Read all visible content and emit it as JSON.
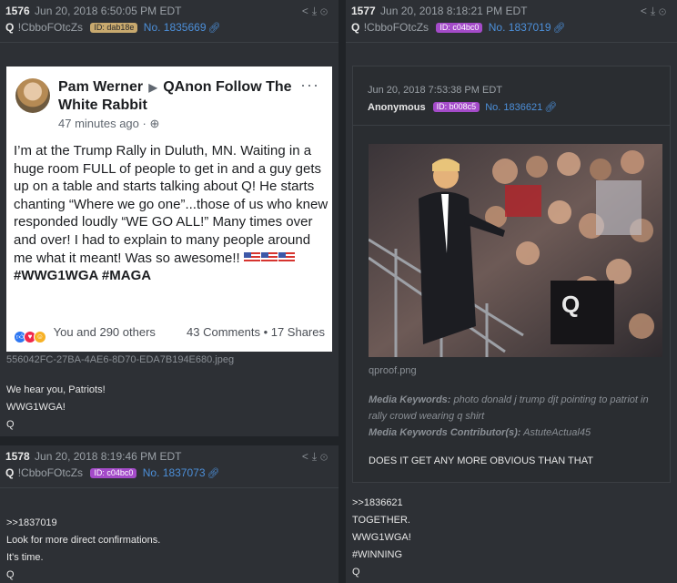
{
  "posts": {
    "p1576": {
      "number": "1576",
      "date": "Jun 20, 2018 6:50:05 PM EDT",
      "name": "Q",
      "tripcode": "!CbboFOtcZs",
      "id_label": "ID: dab18e",
      "post_link": "No. 1835669",
      "facebook": {
        "author": "Pam Werner",
        "group": "QAnon Follow The White Rabbit",
        "time": "47 minutes ago",
        "body": "I’m at the Trump Rally in Duluth, MN. Waiting in a huge room FULL of people to get in and a guy gets up on a table and starts talking about Q! He starts chanting “Where we go one”...those of us who knew responded loudly “WE GO ALL!” Many times over and over! I had to explain to many people around me what it meant! Was so awesome!!",
        "hashtags": "#WWG1WGA  #MAGA",
        "reactions": "You and 290 others",
        "stats": "43 Comments • 17 Shares"
      },
      "filename": "556042FC-27BA-4AE6-8D70-EDA7B194E680.jpeg",
      "message": [
        "We hear you, Patriots!",
        "WWG1WGA!",
        "Q"
      ]
    },
    "p1578": {
      "number": "1578",
      "date": "Jun 20, 2018 8:19:46 PM EDT",
      "name": "Q",
      "tripcode": "!CbboFOtcZs",
      "id_label": "ID: c04bc0",
      "post_link": "No. 1837073",
      "message": [
        ">>1837019",
        "Look for more direct confirmations.",
        "It's time.",
        "Q"
      ]
    },
    "p1577": {
      "number": "1577",
      "date": "Jun 20, 2018 8:18:21 PM EDT",
      "name": "Q",
      "tripcode": "!CbboFOtcZs",
      "id_label": "ID: c04bc0",
      "post_link": "No. 1837019",
      "quoted": {
        "date": "Jun 20, 2018 7:53:38 PM EDT",
        "name": "Anonymous",
        "id_label": "ID: b008c5",
        "post_link": "No. 1836621",
        "filename": "qproof.png",
        "keywords_label": "Media Keywords:",
        "keywords": "photo donald j trump djt pointing to patriot in rally crowd wearing q shirt",
        "contributor_label": "Media Keywords Contributor(s):",
        "contributor": "AstuteActual45",
        "text": "DOES IT GET ANY MORE OBVIOUS THAN THAT"
      },
      "message": [
        ">>1836621",
        "TOGETHER.",
        "WWG1WGA!",
        "#WINNING",
        "Q"
      ]
    }
  },
  "colors": {
    "background": "#202327",
    "post_bg": "#2d3035",
    "link": "#4c8fd9",
    "badge_tan": "#c8a96e",
    "badge_purple": "#a44bc9"
  },
  "icons": [
    "share-icon",
    "download-icon",
    "expand-icon",
    "link-icon",
    "globe-icon",
    "more-icon"
  ]
}
